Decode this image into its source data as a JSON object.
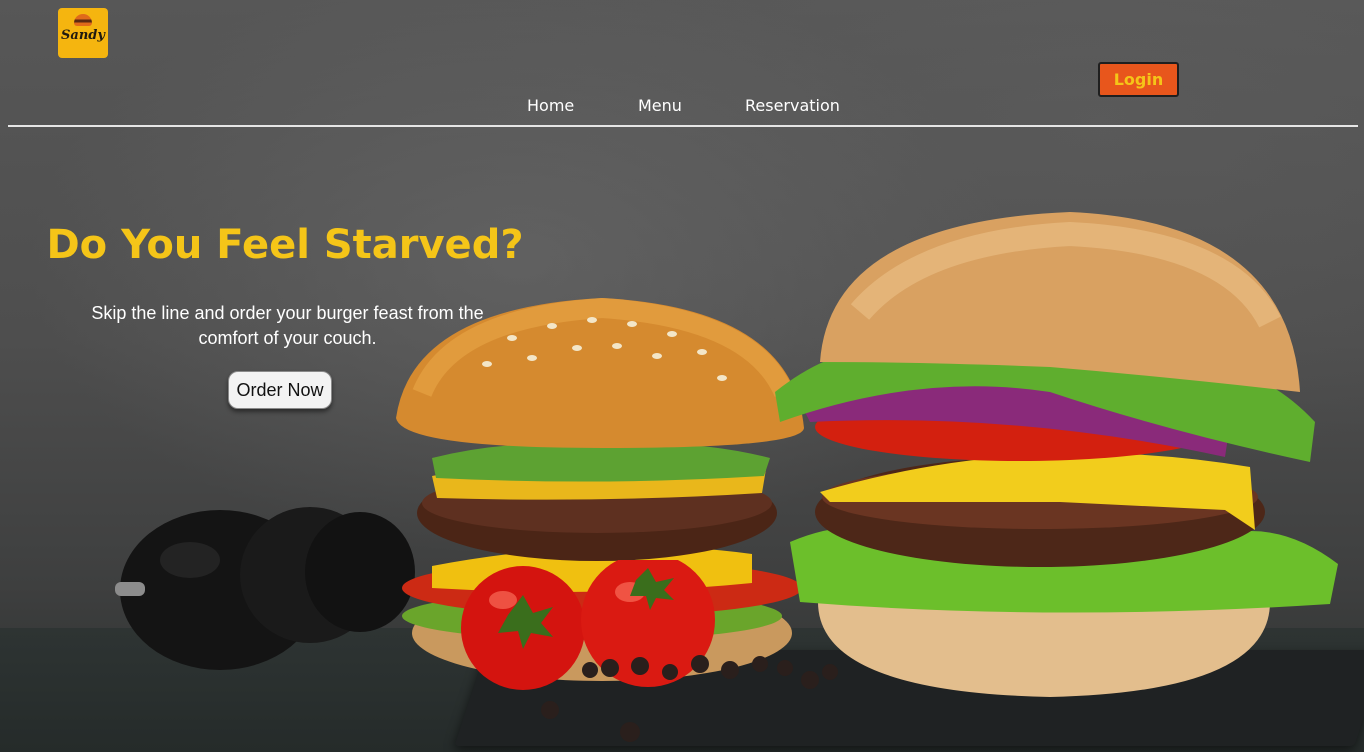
{
  "brand": {
    "logo_text": "Sandy"
  },
  "nav": {
    "items": [
      {
        "label": "Home"
      },
      {
        "label": "Menu"
      },
      {
        "label": "Reservation"
      }
    ],
    "login_label": "Login"
  },
  "hero": {
    "headline": "Do You Feel Starved?",
    "subtitle": "Skip the line and order your burger feast from the comfort of your couch.",
    "cta_label": "Order Now"
  },
  "colors": {
    "accent_yellow": "#f5c518",
    "login_orange": "#e8561c",
    "logo_bg": "#f5b50f"
  }
}
